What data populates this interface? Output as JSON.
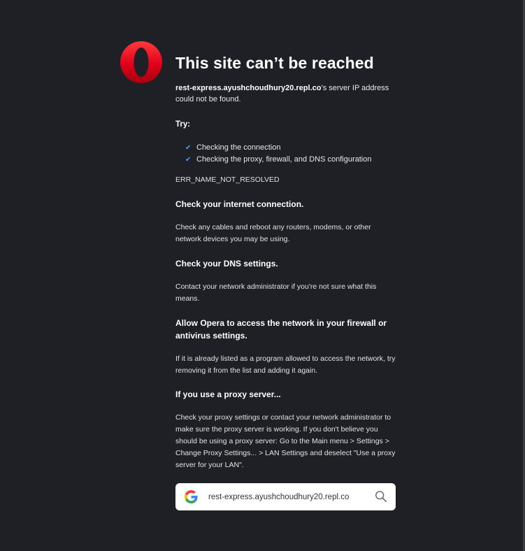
{
  "error_page": {
    "title": "This site can’t be reached",
    "host": "rest-express.ayushchoudhury20.repl.co",
    "host_suffix": "’s server IP address could not be found.",
    "try_label": "Try:",
    "suggestions": [
      "Checking the connection",
      "Checking the proxy, firewall, and DNS configuration"
    ],
    "error_code": "ERR_NAME_NOT_RESOLVED",
    "sections": [
      {
        "title": "Check your internet connection.",
        "body": "Check any cables and reboot any routers, modems, or other network devices you may be using."
      },
      {
        "title": "Check your DNS settings.",
        "body": "Contact your network administrator if you're not sure what this means."
      },
      {
        "title": "Allow Opera to access the network in your firewall or antivirus settings.",
        "body": "If it is already listed as a program allowed to access the network, try removing it from the list and adding it again."
      },
      {
        "title": "If you use a proxy server...",
        "body": "Check your proxy settings or contact your network administrator to make sure the proxy server is working. If you don't believe you should be using a proxy server: Go to the Main menu > Settings > Change Proxy Settings... > LAN Settings and deselect \"Use a proxy server for your LAN\"."
      }
    ]
  },
  "search": {
    "query": "rest-express.ayushchoudhury20.repl.co",
    "engine_icon": "google-icon",
    "search_icon": "search-icon"
  },
  "colors": {
    "background": "#1e2025",
    "accent_check": "#4a9dff",
    "logo_red": "#d7001a"
  },
  "icons": {
    "logo": "opera-logo-icon",
    "check": "checkmark-icon"
  }
}
